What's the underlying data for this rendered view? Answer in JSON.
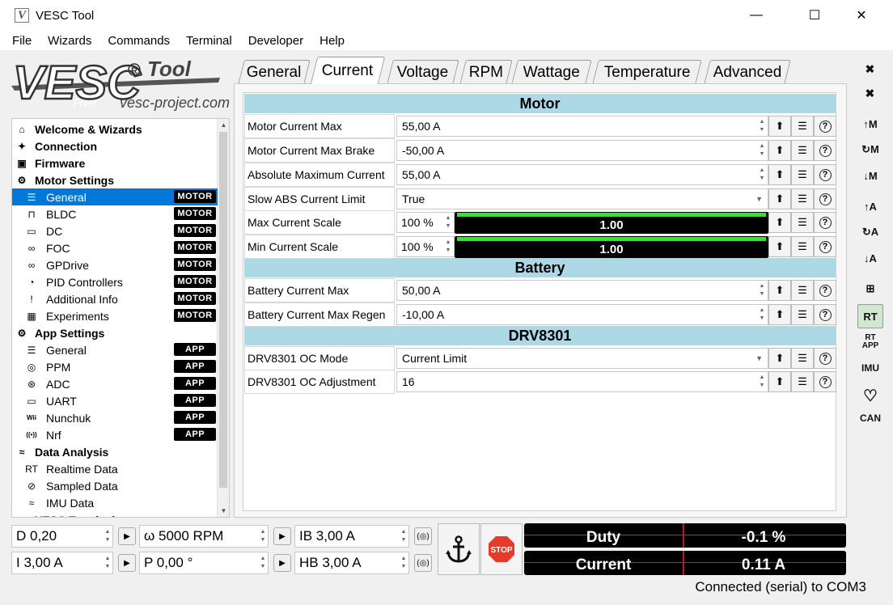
{
  "window": {
    "title": "VESC Tool",
    "minimize": "—",
    "maximize": "☐",
    "close": "✕"
  },
  "menu": [
    "File",
    "Wizards",
    "Commands",
    "Terminal",
    "Developer",
    "Help"
  ],
  "logo": {
    "main": "VESC",
    "tool": "Tool",
    "free": "Free",
    "url": "vesc-project.com"
  },
  "tree": [
    {
      "label": "Welcome & Wizards",
      "icon": "home-icon",
      "glyph": "⌂",
      "type": "hdr"
    },
    {
      "label": "Connection",
      "icon": "plug-icon",
      "glyph": "✦",
      "type": "hdr"
    },
    {
      "label": "Firmware",
      "icon": "chip-icon",
      "glyph": "▣",
      "type": "hdr"
    },
    {
      "label": "Motor Settings",
      "icon": "gear-icon",
      "glyph": "⚙",
      "type": "hdr"
    },
    {
      "label": "General",
      "icon": "sliders-icon",
      "glyph": "☰",
      "type": "sub",
      "badge": "MOTOR",
      "selected": true
    },
    {
      "label": "BLDC",
      "icon": "bldc-icon",
      "glyph": "⊓",
      "type": "sub",
      "badge": "MOTOR"
    },
    {
      "label": "DC",
      "icon": "battery-icon",
      "glyph": "▭",
      "type": "sub",
      "badge": "MOTOR"
    },
    {
      "label": "FOC",
      "icon": "foc-icon",
      "glyph": "∞",
      "type": "sub",
      "badge": "MOTOR"
    },
    {
      "label": "GPDrive",
      "icon": "gpdrive-icon",
      "glyph": "∞",
      "type": "sub",
      "badge": "MOTOR"
    },
    {
      "label": "PID Controllers",
      "icon": "gauge-icon",
      "glyph": "◔",
      "type": "sub",
      "badge": "MOTOR"
    },
    {
      "label": "Additional Info",
      "icon": "info-icon",
      "glyph": "!",
      "type": "sub",
      "badge": "MOTOR"
    },
    {
      "label": "Experiments",
      "icon": "calculator-icon",
      "glyph": "▦",
      "type": "sub",
      "badge": "MOTOR"
    },
    {
      "label": "App Settings",
      "icon": "app-settings-icon",
      "glyph": "⚙",
      "type": "hdr"
    },
    {
      "label": "General",
      "icon": "sliders-icon",
      "glyph": "☰",
      "type": "sub",
      "badge": "APP"
    },
    {
      "label": "PPM",
      "icon": "gamepad-icon",
      "glyph": "◎",
      "type": "sub",
      "badge": "APP"
    },
    {
      "label": "ADC",
      "icon": "adc-icon",
      "glyph": "⊛",
      "type": "sub",
      "badge": "APP"
    },
    {
      "label": "UART",
      "icon": "uart-icon",
      "glyph": "▭",
      "type": "sub",
      "badge": "APP"
    },
    {
      "label": "Nunchuk",
      "icon": "wii-icon",
      "glyph": "Wii",
      "type": "sub",
      "badge": "APP"
    },
    {
      "label": "Nrf",
      "icon": "wireless-icon",
      "glyph": "((•))",
      "type": "sub",
      "badge": "APP"
    },
    {
      "label": "Data Analysis",
      "icon": "analysis-icon",
      "glyph": "≈",
      "type": "hdr"
    },
    {
      "label": "Realtime Data",
      "icon": "realtime-icon",
      "glyph": "RT",
      "type": "sub"
    },
    {
      "label": "Sampled Data",
      "icon": "sampled-icon",
      "glyph": "⊘",
      "type": "sub"
    },
    {
      "label": "IMU Data",
      "icon": "imu-icon",
      "glyph": "≈",
      "type": "sub"
    },
    {
      "label": "VESC Terminal",
      "icon": "terminal-icon",
      "glyph": "▭",
      "type": "hdr"
    }
  ],
  "tabs": [
    "General",
    "Current",
    "Voltage",
    "RPM",
    "Wattage",
    "Temperature",
    "Advanced"
  ],
  "active_tab": "Current",
  "sections": {
    "motor": "Motor",
    "battery": "Battery",
    "drv": "DRV8301"
  },
  "params": {
    "motor_current_max": {
      "label": "Motor Current Max",
      "value": "55,00 A"
    },
    "motor_current_max_brake": {
      "label": "Motor Current Max Brake",
      "value": "-50,00 A"
    },
    "abs_max_current": {
      "label": "Absolute Maximum Current",
      "value": "55,00 A"
    },
    "slow_abs": {
      "label": "Slow ABS Current Limit",
      "value": "True"
    },
    "max_scale": {
      "label": "Max Current Scale",
      "value": "100 %",
      "bar": "1.00",
      "fraction": 1.0
    },
    "min_scale": {
      "label": "Min Current Scale",
      "value": "100 %",
      "bar": "1.00",
      "fraction": 1.0
    },
    "batt_max": {
      "label": "Battery Current Max",
      "value": "50,00 A"
    },
    "batt_regen": {
      "label": "Battery Current Max Regen",
      "value": "-10,00 A"
    },
    "oc_mode": {
      "label": "DRV8301 OC Mode",
      "value": "Current Limit"
    },
    "oc_adj": {
      "label": "DRV8301 OC Adjustment",
      "value": "16"
    }
  },
  "controls": {
    "duty": "D 0,20",
    "rpm": "ω 5000 RPM",
    "ib": "IB 3,00 A",
    "current": "I 3,00 A",
    "pos": "P 0,00 °",
    "hb": "HB 3,00 A",
    "stop": "STOP"
  },
  "gauges": {
    "duty_label": "Duty",
    "duty_value": "-0.1 %",
    "current_label": "Current",
    "current_value": "0.11 A"
  },
  "status": "Connected (serial) to COM3",
  "right_toolbar": [
    "connect-icon",
    "disconnect-icon",
    "read-motor-icon",
    "read-motor-default-icon",
    "write-motor-icon",
    "read-app-icon",
    "read-app-default-icon",
    "write-app-icon",
    "can-fwd-icon",
    "rt-data-icon",
    "rt-app-icon",
    "imu-icon",
    "heart-icon",
    "can-icon"
  ],
  "colors": {
    "accent": "#0078d7",
    "section": "#add8e6",
    "bar": "#2ee62e"
  }
}
